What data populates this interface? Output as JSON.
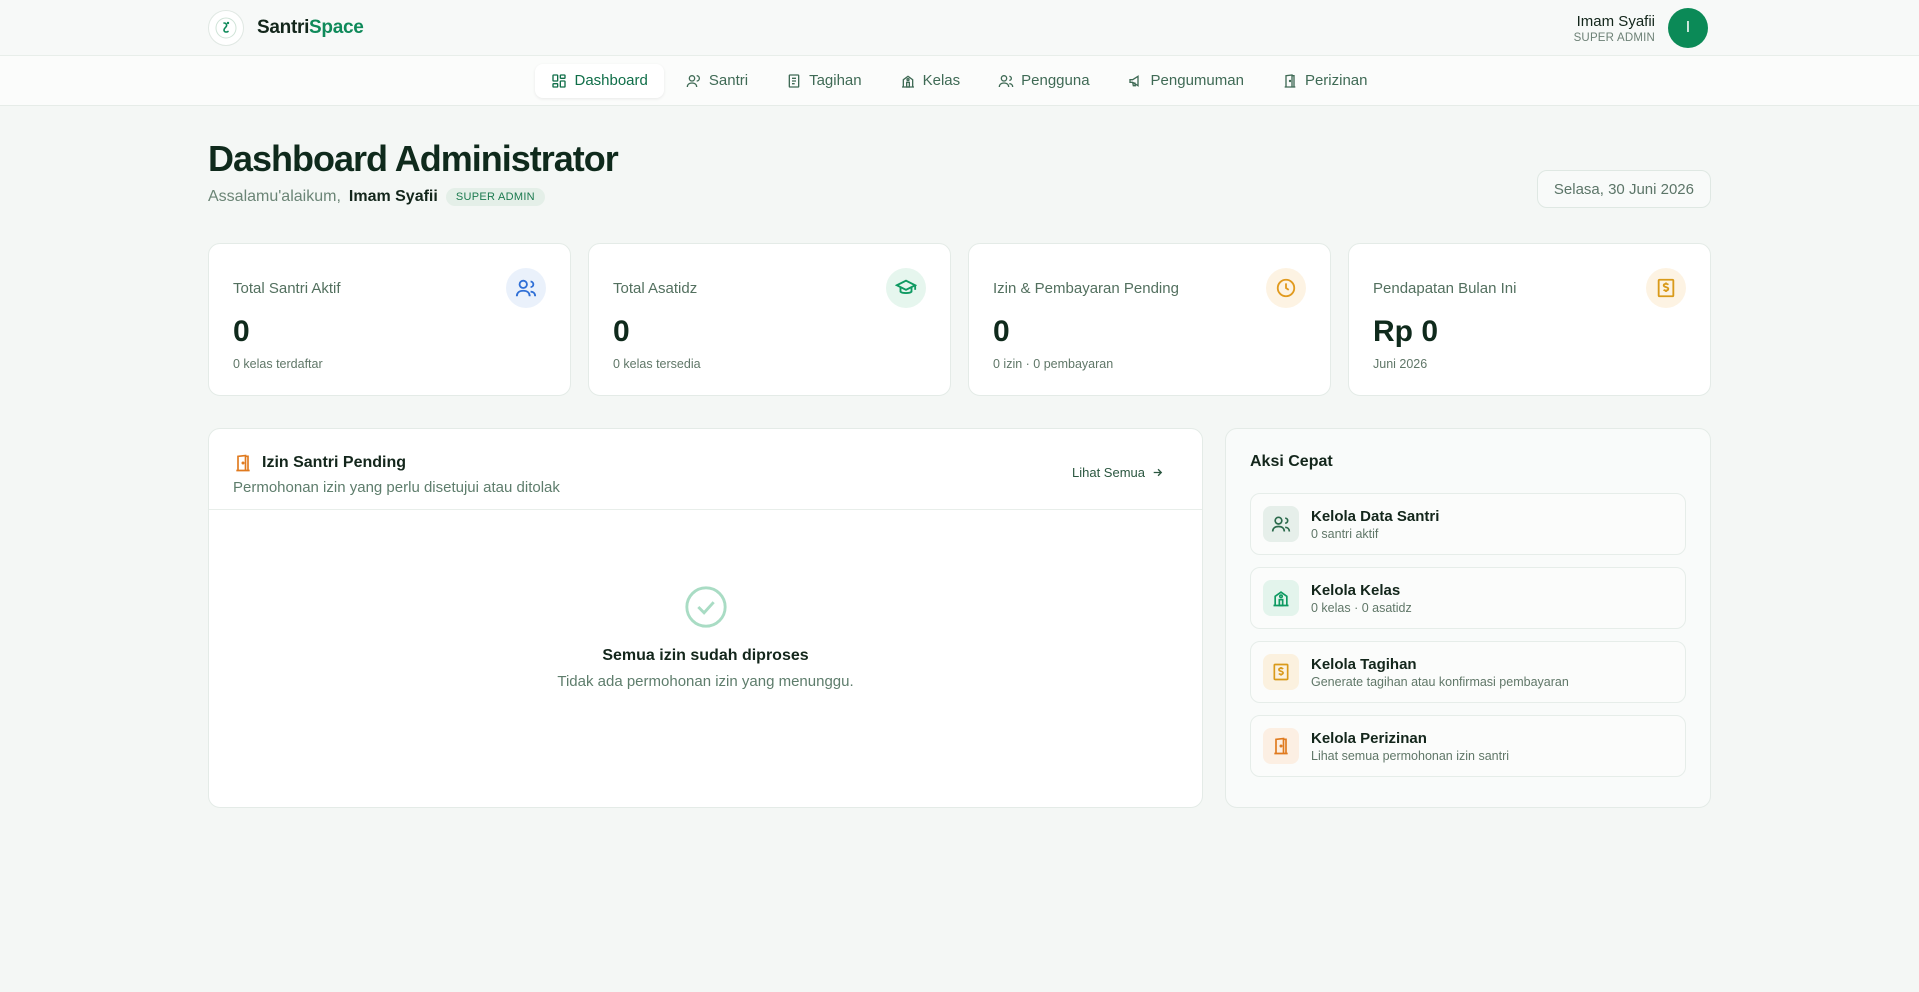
{
  "brand": {
    "name_part1": "Santri",
    "name_part2": "Space",
    "logo_icon": "santri-logo-icon"
  },
  "user": {
    "name": "Imam Syafii",
    "role": "SUPER ADMIN",
    "initial": "I"
  },
  "nav": [
    {
      "label": "Dashboard",
      "icon": "grid-icon",
      "active": true
    },
    {
      "label": "Santri",
      "icon": "user-icon"
    },
    {
      "label": "Tagihan",
      "icon": "receipt-icon"
    },
    {
      "label": "Kelas",
      "icon": "school-icon"
    },
    {
      "label": "Pengguna",
      "icon": "users-icon"
    },
    {
      "label": "Pengumuman",
      "icon": "megaphone-icon"
    },
    {
      "label": "Perizinan",
      "icon": "door-icon"
    }
  ],
  "header": {
    "title": "Dashboard Administrator",
    "greeting": "Assalamu'alaikum,",
    "greeting_name": "Imam Syafii",
    "role_badge": "SUPER ADMIN",
    "date": "Selasa, 30 Juni 2026"
  },
  "stats": [
    {
      "label": "Total Santri Aktif",
      "value": "0",
      "sub": "0 kelas terdaftar",
      "icon": "users-icon",
      "color": "#2f6fd6",
      "bg": "#eaf1fb"
    },
    {
      "label": "Total Asatidz",
      "value": "0",
      "sub": "0 kelas tersedia",
      "icon": "graduation-cap-icon",
      "color": "#0f9a62",
      "bg": "#e6f6ee"
    },
    {
      "label": "Izin & Pembayaran Pending",
      "value": "0",
      "sub": "0 izin · 0 pembayaran",
      "icon": "clock-icon",
      "color": "#e19a1e",
      "bg": "#fdf3e3"
    },
    {
      "label": "Pendapatan Bulan Ini",
      "value": "Rp 0",
      "sub": "Juni 2026",
      "icon": "dollar-receipt-icon",
      "color": "#d99a1a",
      "bg": "#fdf3e3"
    }
  ],
  "pending": {
    "title": "Izin Santri Pending",
    "description": "Permohonan izin yang perlu disetujui atau ditolak",
    "see_all": "Lihat Semua",
    "empty_title": "Semua izin sudah diproses",
    "empty_desc": "Tidak ada permohonan izin yang menunggu."
  },
  "quick": {
    "title": "Aksi Cepat",
    "items": [
      {
        "name": "Kelola Data Santri",
        "desc": "0 santri aktif",
        "icon": "users-icon",
        "color": "#2b6a4c",
        "bg": "#e6efea"
      },
      {
        "name": "Kelola Kelas",
        "desc": "0 kelas · 0 asatidz",
        "icon": "school-icon",
        "color": "#0f9a62",
        "bg": "#e3f4ec"
      },
      {
        "name": "Kelola Tagihan",
        "desc": "Generate tagihan atau konfirmasi pembayaran",
        "icon": "dollar-receipt-icon",
        "color": "#d99a1a",
        "bg": "#fbf1df"
      },
      {
        "name": "Kelola Perizinan",
        "desc": "Lihat semua permohonan izin santri",
        "icon": "door-icon",
        "color": "#e07a1e",
        "bg": "#fcefe3"
      }
    ]
  },
  "colors": {
    "primary": "#0f8a5a",
    "accent_green": "#0b8a57"
  }
}
